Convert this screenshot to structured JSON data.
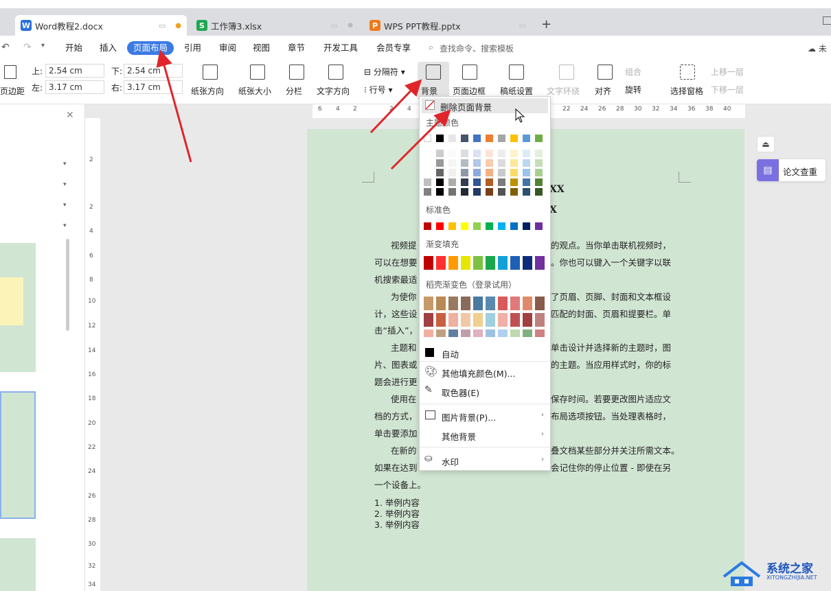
{
  "tabs": [
    {
      "label": "Word教程2.docx",
      "icon": "W",
      "color": "#2a6fe0"
    },
    {
      "label": "工作簿3.xlsx",
      "icon": "S",
      "color": "#1fa855"
    },
    {
      "label": "WPS PPT教程.pptx",
      "icon": "P",
      "color": "#f07a1b"
    }
  ],
  "tab_add": "+",
  "menu": {
    "items": [
      "开始",
      "插入",
      "页面布局",
      "引用",
      "审阅",
      "视图",
      "章节",
      "开发工具",
      "会员专享"
    ],
    "active": "页面布局",
    "search_placeholder": "查找命令、搜索模板",
    "right_label": "未"
  },
  "toolbar": {
    "margin_label": "页边距",
    "top_label": "上:",
    "top_value": "2.54 cm",
    "bottom_label": "下:",
    "bottom_value": "2.54 cm",
    "left_label": "左:",
    "left_value": "3.17 cm",
    "right_label": "右:",
    "right_value": "3.17 cm",
    "orientation": "纸张方向",
    "size": "纸张大小",
    "columns": "分栏",
    "text_dir": "文字方向",
    "separator": "分隔符",
    "line_no": "行号",
    "background": "背景",
    "page_border": "页面边框",
    "paper_setting": "稿纸设置",
    "text_wrap": "文字环绕",
    "align": "对齐",
    "group": "组合",
    "rotate": "旋转",
    "select_pane": "选择窗格",
    "bring_forward": "上移一层",
    "send_backward": "下移一层"
  },
  "ruler_top": [
    "6",
    "4",
    "2",
    "2",
    "4",
    "22",
    "24",
    "26",
    "28",
    "30",
    "32",
    "34",
    "36",
    "38",
    "40"
  ],
  "ruler_left": [
    "2",
    "2",
    "4",
    "6",
    "8",
    "10",
    "12",
    "14",
    "16",
    "18",
    "20",
    "22",
    "24",
    "26",
    "28",
    "30",
    "32",
    "34"
  ],
  "dropdown": {
    "remove_bg": "删除页面背景",
    "theme_colors": "主题颜色",
    "standard_colors": "标准色",
    "gradient_fill": "渐变填充",
    "shell_gradient": "稻壳渐变色（登录试用）",
    "auto": "自动",
    "more_fill": "其他填充颜色(M)...",
    "eyedropper": "取色器(E)",
    "picture_bg": "图片背景(P)...",
    "other_bg": "其他背景",
    "watermark": "水印",
    "theme_top_row": [
      "#ffffff",
      "#000000",
      "#e7e6e6",
      "#44546a",
      "#4472c4",
      "#ed7d31",
      "#a5a5a5",
      "#ffc000",
      "#5b9bd5",
      "#70ad47"
    ],
    "standard_row": [
      "#c00000",
      "#ff0000",
      "#ffc000",
      "#ffff00",
      "#92d050",
      "#00b050",
      "#00b0f0",
      "#0070c0",
      "#002060",
      "#7030a0"
    ],
    "gradient_row": [
      "#c00000",
      "#ff3030",
      "#ff9a00",
      "#e6e600",
      "#7cc242",
      "#1aa64a",
      "#12a0d8",
      "#1f5fb5",
      "#0d2b7a",
      "#7030a0"
    ]
  },
  "right_panel": {
    "thesis_check": "论文查重"
  },
  "document": {
    "heading1": "XX",
    "heading2": "X",
    "lines": [
      "视频提",
      "的观点。当你单击联机视频时，",
      "可以在想要",
      "。你也可以键入一个关键字以联",
      "机搜索最适",
      "为使你",
      "了页眉、页脚、封面和文本框设",
      "计，这些设",
      "匹配的封面、页眉和提要栏。单",
      "击“插入”，",
      "主题和",
      "单击设计并选择新的主题时，图",
      "片、图表或",
      "的主题。当应用样式时，你的标",
      "题会进行更",
      "使用在",
      "保存时间。若要更改图片适应文",
      "档的方式，",
      "布局选项按钮。当处理表格时，",
      "单击要添加",
      "在新的",
      "叠文档某些部分并关注所需文本。",
      "如果在达到",
      "会记住你的停止位置 - 即使在另",
      "一个设备上。"
    ],
    "list": [
      "1. 举例内容",
      "2. 举例内容",
      "3. 举例内容"
    ]
  },
  "watermark": {
    "site": "系统之家",
    "url": "XITONGZHIJIA.NET"
  },
  "colors": {
    "accent": "#3c7be6",
    "page_bg": "#d1e5d3",
    "arrow": "#e0252a"
  }
}
